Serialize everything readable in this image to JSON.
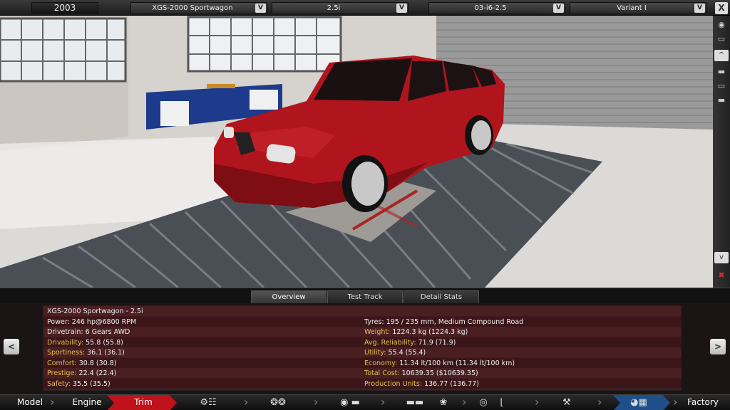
{
  "top_bar": {
    "year": "2003",
    "model": "XGS-2000 Sportwagon",
    "trim": "2.5i",
    "engine": "03-i6-2.5",
    "variant": "Variant I",
    "dropdown_glyph": "V",
    "close_glyph": "X"
  },
  "sidebar": {
    "scroll_up_glyph": "^",
    "scroll_down_glyph": "v"
  },
  "tabs": [
    {
      "label": "Overview",
      "active": true
    },
    {
      "label": "Test Track",
      "active": false
    },
    {
      "label": "Detail Stats",
      "active": false
    }
  ],
  "info": {
    "left": [
      {
        "text": "XGS-2000 Sportwagon - 2.5i",
        "color": "white"
      },
      {
        "text": "Power: 246 hp@6800 RPM",
        "color": "white"
      },
      {
        "text": "Drivetrain: 6 Gears AWD",
        "color": "white"
      },
      {
        "text": "Drivability: 55.8 (55.8)",
        "label": "Drivability:",
        "value": "55.8 (55.8)"
      },
      {
        "text": "Sportiness: 36.1 (36.1)",
        "label": "Sportiness:",
        "value": "36.1 (36.1)"
      },
      {
        "text": "Comfort: 30.8 (30.8)",
        "label": "Comfort:",
        "value": "30.8 (30.8)"
      },
      {
        "text": "Prestige: 22.4 (22.4)",
        "label": "Prestige:",
        "value": "22.4 (22.4)"
      },
      {
        "text": "Safety: 35.5 (35.5)",
        "label": "Safety:",
        "value": "35.5 (35.5)"
      }
    ],
    "right": [
      {
        "text": "Tyres: 195 / 235 mm, Medium Compound Road",
        "color": "white"
      },
      {
        "label": "Weight:",
        "value": "1224.3 kg (1224.3 kg)"
      },
      {
        "label": "Avg. Reliability:",
        "value": "71.9 (71.9)"
      },
      {
        "label": "Utility:",
        "value": "55.4 (55.4)"
      },
      {
        "label": "Economy:",
        "value": "11.34 lt/100 km (11.34 lt/100 km)"
      },
      {
        "label": "Total Cost:",
        "value": "10639.35 ($10639.35)"
      },
      {
        "label": "Production Units:",
        "value": "136.77 (136.77)"
      }
    ],
    "prev_glyph": "<",
    "next_glyph": ">"
  },
  "bottom_nav": {
    "model": "Model",
    "engine": "Engine",
    "trim": "Trim",
    "factory": "Factory",
    "icons": [
      "gearbox-icon",
      "suspension-icon",
      "body-icon",
      "car-icon",
      "fan-icon",
      "steering-icon",
      "seat-icon",
      "tools-icon",
      "testdrive-icon"
    ]
  },
  "colors": {
    "car_red": "#b0141d",
    "accent_red": "#c0121b",
    "highlight_yellow": "#e4c04c",
    "panel_row_dark": "#3b1619",
    "panel_row_light": "#4a1f22"
  }
}
